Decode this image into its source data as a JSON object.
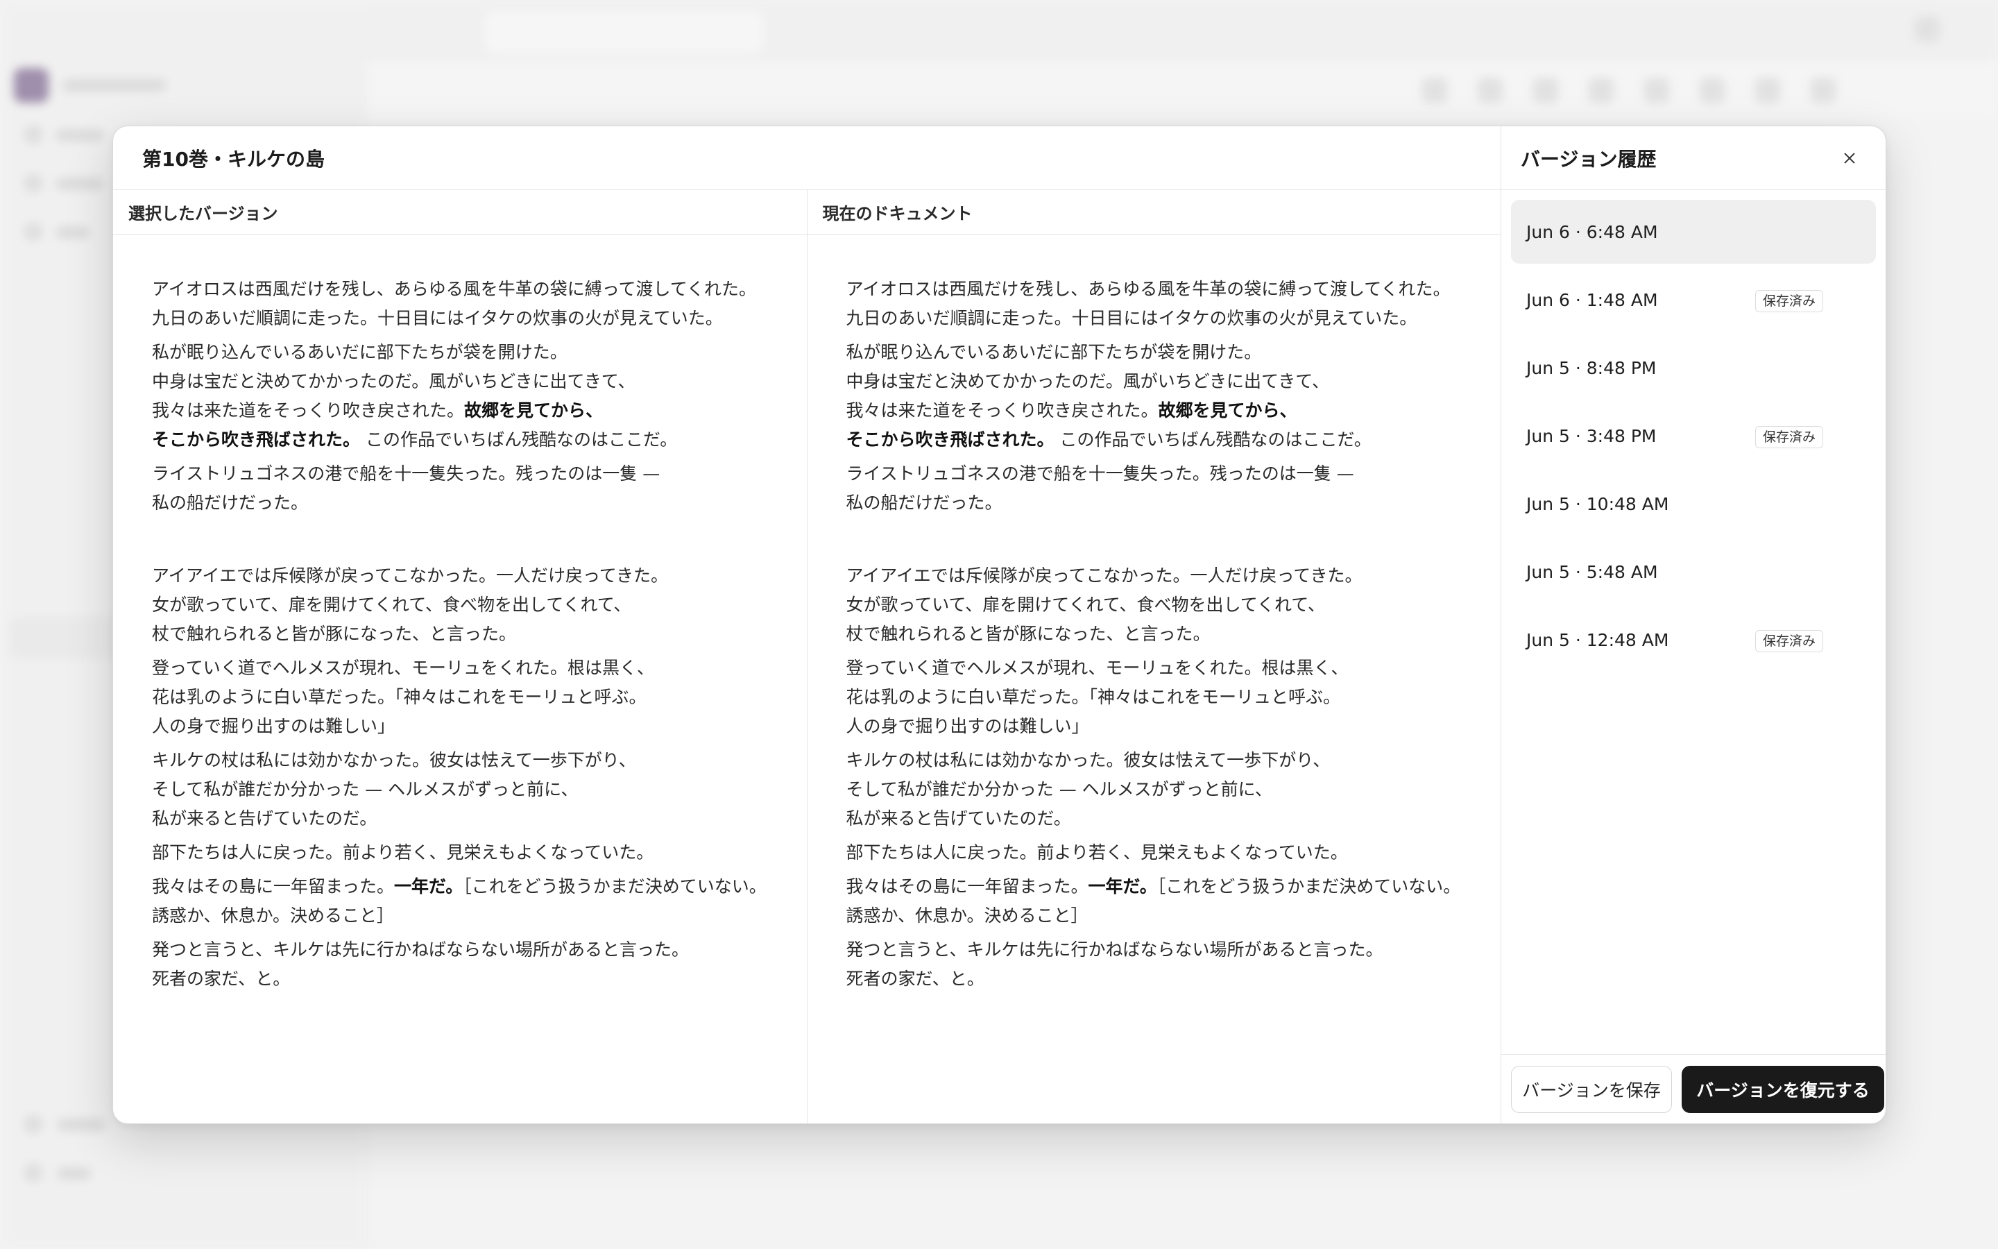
{
  "document": {
    "title": "第10巻・キルケの島"
  },
  "columns": {
    "selected_header": "選択したバージョン",
    "current_header": "現在のドキュメント"
  },
  "text": {
    "p1": [
      "アイオロスは西風だけを残し、あらゆる風を牛革の袋に縛って渡してくれた。",
      "九日のあいだ順調に走った。十日目にはイタケの炊事の火が見えていた。"
    ],
    "p2_l1": "私が眠り込んでいるあいだに部下たちが袋を開けた。",
    "p2_l2": "中身は宝だと決めてかかったのだ。風がいちどきに出てきて、",
    "p2_l3_pre": "我々は来た道をそっくり吹き戻された。",
    "p2_l3_bold": "故郷を見てから、",
    "p2_l4_bold": "そこから吹き飛ばされた。",
    "p2_l4_post": " この作品でいちばん残酷なのはここだ。",
    "p3": [
      "ライストリュゴネスの港で船を十一隻失った。残ったのは一隻 —",
      "私の船だけだった。"
    ],
    "p4": [
      "アイアイエでは斥候隊が戻ってこなかった。一人だけ戻ってきた。",
      "女が歌っていて、扉を開けてくれて、食べ物を出してくれて、",
      "杖で触れられると皆が豚になった、と言った。"
    ],
    "p5": [
      "登っていく道でヘルメスが現れ、モーリュをくれた。根は黒く、",
      "花は乳のように白い草だった。「神々はこれをモーリュと呼ぶ。",
      "人の身で掘り出すのは難しい」"
    ],
    "p6": [
      "キルケの杖は私には効かなかった。彼女は怯えて一歩下がり、",
      "そして私が誰だか分かった — ヘルメスがずっと前に、",
      "私が来ると告げていたのだ。"
    ],
    "p7": [
      "部下たちは人に戻った。前より若く、見栄えもよくなっていた。"
    ],
    "p8_l1_pre": "我々はその島に一年留まった。",
    "p8_l1_bold": "一年だ。",
    "p8_l1_post": "［これをどう扱うかまだ決めていない。",
    "p8_l2": "誘惑か、休息か。決めること］",
    "p9": [
      "発つと言うと、キルケは先に行かねばならない場所があると言った。",
      "死者の家だ、と。"
    ]
  },
  "history": {
    "title": "バージョン履歴",
    "versions": [
      {
        "time": "Jun 6 · 6:48 AM",
        "badge": ""
      },
      {
        "time": "Jun 6 · 1:48 AM",
        "badge": "保存済み"
      },
      {
        "time": "Jun 5 · 8:48 PM",
        "badge": ""
      },
      {
        "time": "Jun 5 · 3:48 PM",
        "badge": "保存済み"
      },
      {
        "time": "Jun 5 · 10:48 AM",
        "badge": ""
      },
      {
        "time": "Jun 5 · 5:48 AM",
        "badge": ""
      },
      {
        "time": "Jun 5 · 12:48 AM",
        "badge": "保存済み"
      }
    ],
    "save_label": "バージョンを保存",
    "restore_label": "バージョンを復元する"
  },
  "icons": {
    "close": "close-icon"
  },
  "colors": {
    "primary_button": "#1a1a1a",
    "selected_row": "#efefef"
  }
}
